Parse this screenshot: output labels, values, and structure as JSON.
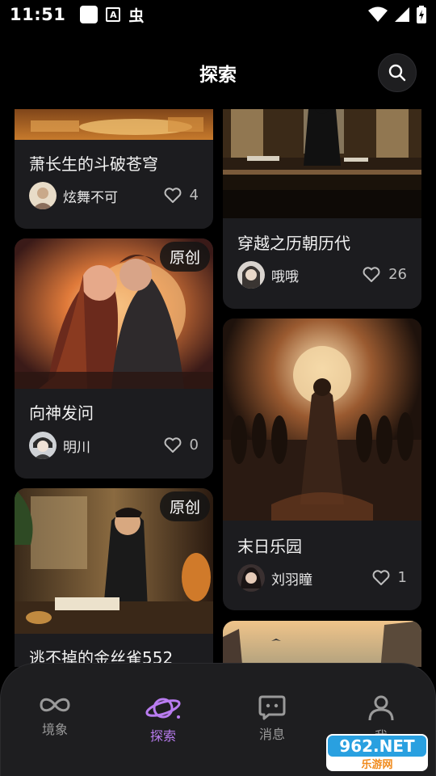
{
  "status_bar": {
    "time": "11:51",
    "notif_a": "A",
    "notif_bug": "虫"
  },
  "header": {
    "title": "探索"
  },
  "cards": [
    {
      "title": "萧长生的斗破苍穹",
      "author": "炫舞不可",
      "likes": "4"
    },
    {
      "title": "穿越之历朝历代",
      "author": "哦哦",
      "likes": "26"
    },
    {
      "title": "向神发问",
      "author": "明川",
      "likes": "0",
      "badge": "原创"
    },
    {
      "title": "末日乐园",
      "author": "刘羽瞳",
      "likes": "1"
    },
    {
      "title": "逃不掉的金丝雀552",
      "badge": "原创"
    }
  ],
  "nav": {
    "items": [
      {
        "label": "境象",
        "icon": "infinity-icon"
      },
      {
        "label": "探索",
        "icon": "planet-icon"
      },
      {
        "label": "消息",
        "icon": "chat-icon"
      },
      {
        "label": "我",
        "icon": "person-icon"
      }
    ],
    "active_color": "#b97cf0"
  },
  "watermark": {
    "text_main": "962.NET",
    "text_sub": "乐游网"
  }
}
